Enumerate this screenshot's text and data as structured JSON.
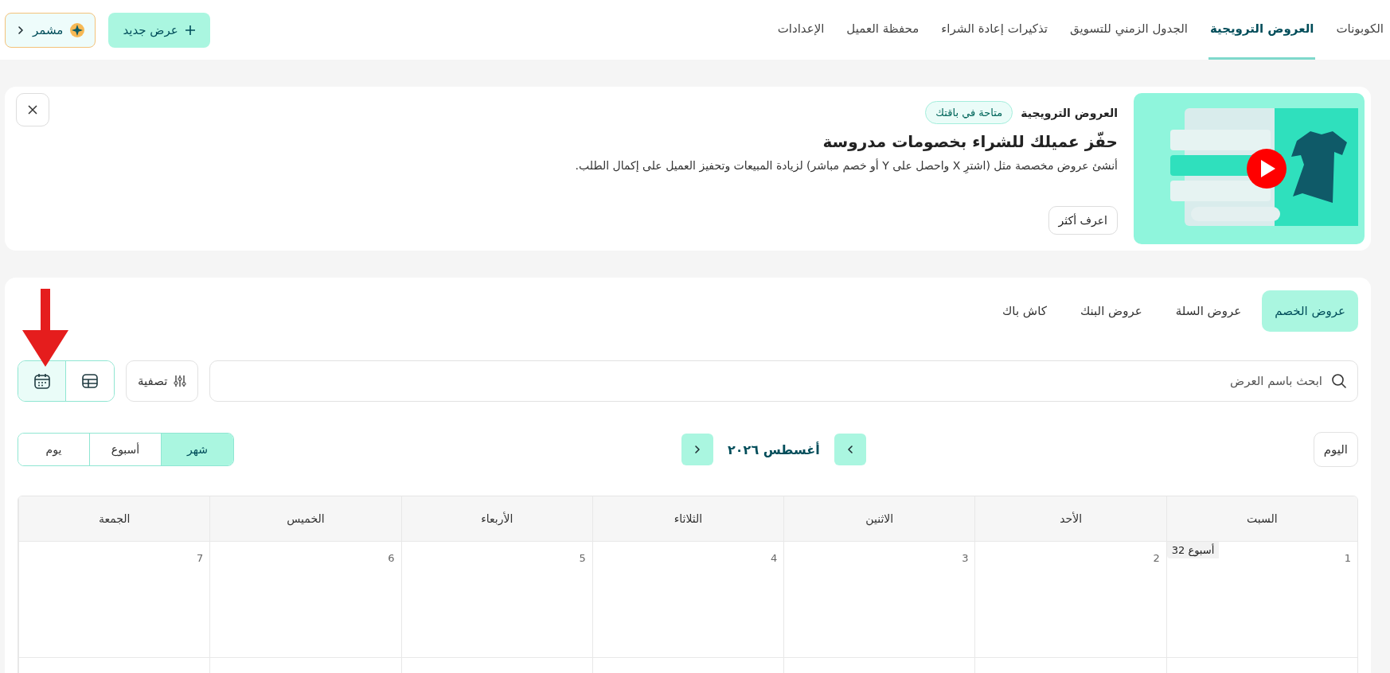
{
  "topbar": {
    "nav": [
      {
        "label": "الكوبونات",
        "selected": false
      },
      {
        "label": "العروض الترويجية",
        "selected": true
      },
      {
        "label": "الجدول الزمني للتسويق",
        "selected": false
      },
      {
        "label": "تذكيرات إعادة الشراء",
        "selected": false
      },
      {
        "label": "محفظة العميل",
        "selected": false
      },
      {
        "label": "الإعدادات",
        "selected": false
      }
    ],
    "new_button": "عرض جديد",
    "assistant_button": "مشمر"
  },
  "banner": {
    "kicker": "العروض الترويجية",
    "badge": "متاحة في باقتك",
    "title": "حفّز عميلك للشراء بخصومات مدروسة",
    "description": "أنشئ عروض مخصصة مثل (اشترِ X واحصل على Y أو خصم مباشر) لزيادة المبيعات وتحفيز العميل على إكمال الطلب.",
    "learn_more": "اعرف أكثر"
  },
  "offer_tabs": [
    {
      "label": "عروض الخصم",
      "selected": true
    },
    {
      "label": "عروض السلة",
      "selected": false
    },
    {
      "label": "عروض البنك",
      "selected": false
    },
    {
      "label": "كاش باك",
      "selected": false
    }
  ],
  "search": {
    "placeholder": "ابحث باسم العرض"
  },
  "filter_button": "تصفية",
  "view_toggle": [
    {
      "kind": "table",
      "selected": false
    },
    {
      "kind": "calendar",
      "selected": true
    }
  ],
  "calendar": {
    "today_button": "اليوم",
    "month_label": "أغسطس ٢٠٢٦",
    "modes": [
      {
        "label": "شهر",
        "selected": true
      },
      {
        "label": "أسبوع",
        "selected": false
      },
      {
        "label": "يوم",
        "selected": false
      }
    ],
    "weekdays": [
      "السبت",
      "الأحد",
      "الاثنين",
      "الثلاثاء",
      "الأربعاء",
      "الخميس",
      "الجمعة"
    ],
    "weeks": [
      {
        "label": "أسبوع 32",
        "days": [
          "1",
          "2",
          "3",
          "4",
          "5",
          "6",
          "7"
        ]
      }
    ]
  }
}
